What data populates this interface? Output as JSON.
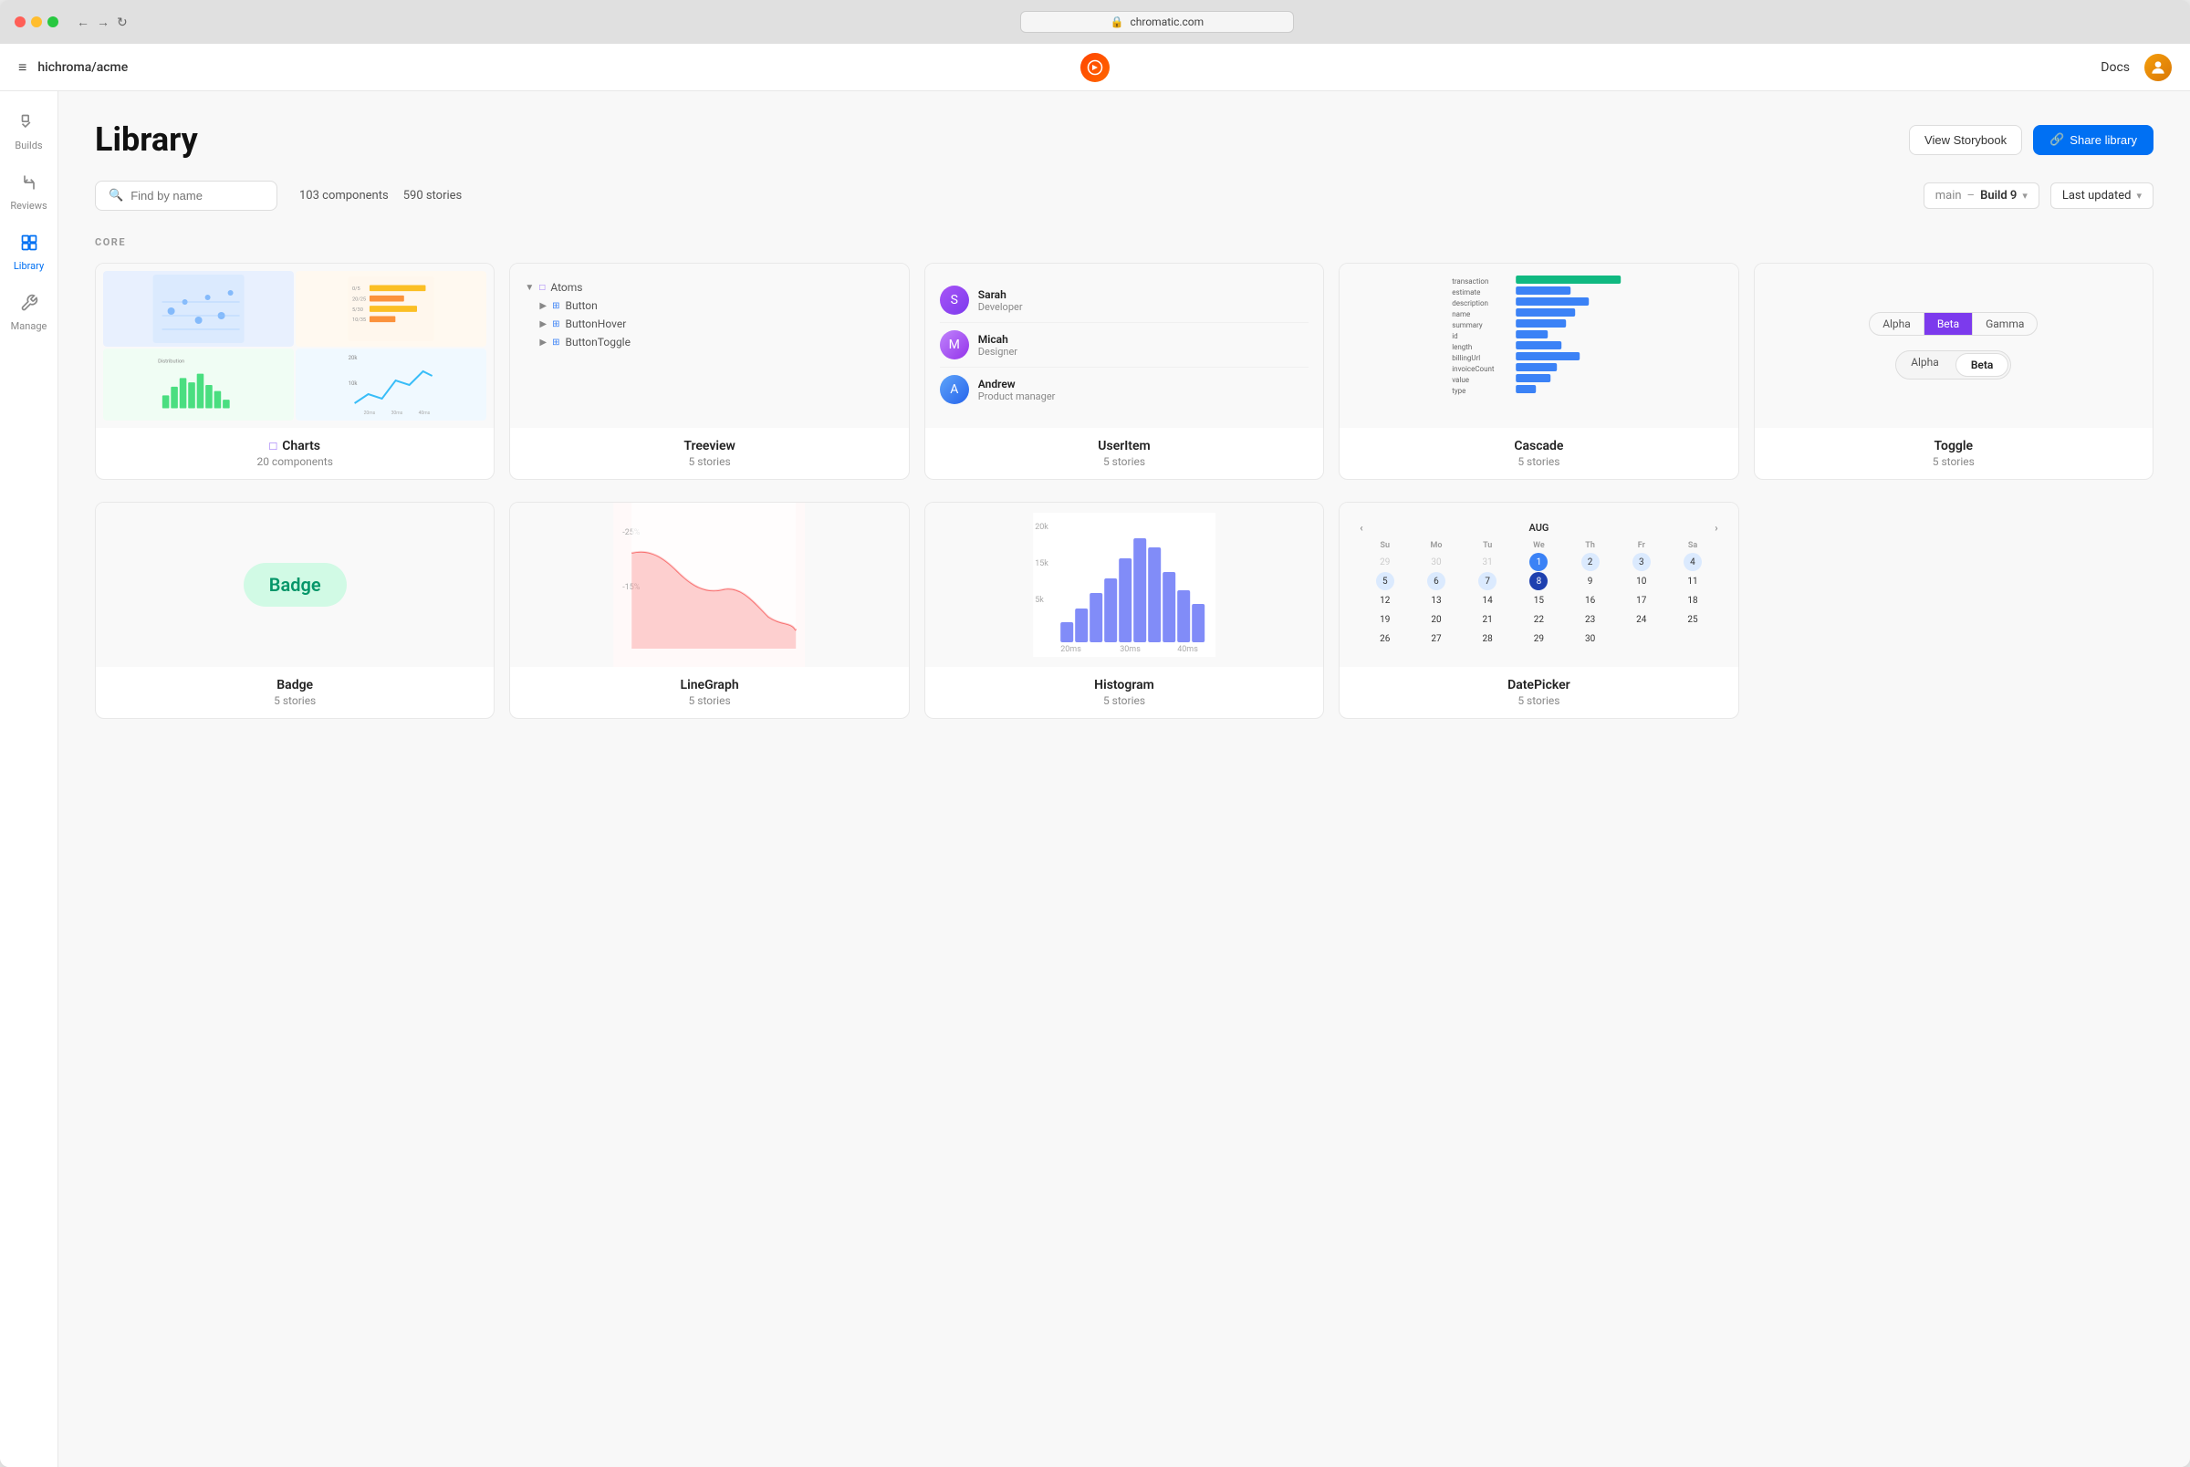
{
  "browser": {
    "url": "chromatic.com",
    "back": "←",
    "forward": "→",
    "refresh": "↻"
  },
  "header": {
    "menu_icon": "≡",
    "brand": "hichroma/acme",
    "docs_label": "Docs"
  },
  "sidebar": {
    "items": [
      {
        "id": "builds",
        "label": "Builds",
        "icon": "✓"
      },
      {
        "id": "reviews",
        "label": "Reviews",
        "icon": "⑂"
      },
      {
        "id": "library",
        "label": "Library",
        "icon": "⊞",
        "active": true
      },
      {
        "id": "manage",
        "label": "Manage",
        "icon": "⚙"
      }
    ]
  },
  "library": {
    "title": "Library",
    "view_storybook_label": "View Storybook",
    "share_library_label": "Share library",
    "share_icon": "🔗",
    "components_count": "103 components",
    "stories_count": "590 stories",
    "search_placeholder": "Find by name",
    "branch": "main",
    "build": "Build 9",
    "sort_label": "Last updated",
    "section_core": "CORE"
  },
  "components": [
    {
      "id": "charts",
      "name": "Charts",
      "count": "20 components",
      "has_folder_icon": true,
      "type": "charts"
    },
    {
      "id": "treeview",
      "name": "Treeview",
      "count": "5 stories",
      "has_folder_icon": false,
      "type": "treeview"
    },
    {
      "id": "useritem",
      "name": "UserItem",
      "count": "5 stories",
      "has_folder_icon": false,
      "type": "useritem"
    },
    {
      "id": "cascade",
      "name": "Cascade",
      "count": "5 stories",
      "has_folder_icon": false,
      "type": "cascade"
    },
    {
      "id": "toggle",
      "name": "Toggle",
      "count": "5 stories",
      "has_folder_icon": false,
      "type": "toggle"
    }
  ],
  "components_row2": [
    {
      "id": "badge",
      "name": "Badge",
      "count": "5 stories",
      "type": "badge"
    },
    {
      "id": "linegraph",
      "name": "LineGraph",
      "count": "5 stories",
      "type": "linegraph"
    },
    {
      "id": "histogram",
      "name": "Histogram",
      "count": "5 stories",
      "type": "histogram"
    },
    {
      "id": "datepicker",
      "name": "DatePicker",
      "count": "5 stories",
      "type": "datepicker"
    }
  ],
  "treeview_items": [
    {
      "label": "Atoms",
      "indent": 0,
      "type": "folder"
    },
    {
      "label": "Button",
      "indent": 1,
      "type": "component"
    },
    {
      "label": "ButtonHover",
      "indent": 1,
      "type": "component"
    },
    {
      "label": "ButtonToggle",
      "indent": 1,
      "type": "component"
    }
  ],
  "users": [
    {
      "name": "Sarah",
      "role": "Developer",
      "color": "purple"
    },
    {
      "name": "Micah",
      "role": "Designer",
      "color": "brown"
    },
    {
      "name": "Andrew",
      "role": "Product manager",
      "color": "blue"
    }
  ],
  "cascade_rows": [
    {
      "label": "transaction",
      "width": 100,
      "color": "green"
    },
    {
      "label": "estimate",
      "width": 55,
      "color": "blue"
    },
    {
      "label": "description",
      "width": 75,
      "color": "blue"
    },
    {
      "label": "name",
      "width": 60,
      "color": "blue"
    },
    {
      "label": "summary",
      "width": 50,
      "color": "blue"
    },
    {
      "label": "id",
      "width": 30,
      "color": "blue"
    },
    {
      "label": "length",
      "width": 45,
      "color": "blue"
    },
    {
      "label": "billingUrl",
      "width": 65,
      "color": "blue"
    },
    {
      "label": "invoiceCount",
      "width": 40,
      "color": "blue"
    },
    {
      "label": "value",
      "width": 35,
      "color": "blue"
    },
    {
      "label": "type",
      "width": 20,
      "color": "blue"
    }
  ],
  "toggle_groups": [
    {
      "options": [
        "Alpha",
        "Beta",
        "Gamma"
      ],
      "active": 1,
      "style": "colored"
    },
    {
      "options": [
        "Alpha",
        "Beta"
      ],
      "active": 1,
      "style": "gray"
    }
  ],
  "histogram_bars": [
    30,
    45,
    65,
    75,
    90,
    110,
    100,
    80,
    60,
    50
  ],
  "histogram_labels": [
    "20ms",
    "30ms",
    "40ms"
  ],
  "datepicker": {
    "month": "AUG",
    "days_header": [
      "Su",
      "Mo",
      "Tu",
      "We",
      "Th",
      "Fr",
      "Sa"
    ],
    "weeks": [
      [
        "29",
        "30",
        "31",
        "1",
        "2",
        "3",
        "4"
      ],
      [
        "5",
        "6",
        "7",
        "8",
        "9",
        "10",
        "11"
      ],
      [
        "12",
        "13",
        "14",
        "15",
        "16",
        "17",
        "18"
      ],
      [
        "19",
        "20",
        "21",
        "22",
        "23",
        "24",
        "25"
      ],
      [
        "26",
        "27",
        "28",
        "29",
        "30",
        "",
        ""
      ]
    ],
    "today": "1",
    "selected": "8",
    "highlighted_row": 1
  }
}
